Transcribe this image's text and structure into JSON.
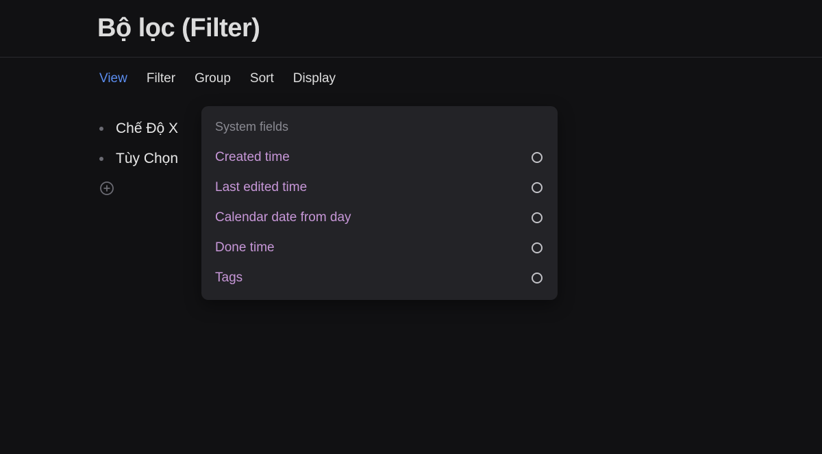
{
  "header": {
    "title": "Bộ lọc (Filter)"
  },
  "toolbar": {
    "tabs": [
      {
        "label": "View",
        "active": true
      },
      {
        "label": "Filter",
        "active": false
      },
      {
        "label": "Group",
        "active": false
      },
      {
        "label": "Sort",
        "active": false
      },
      {
        "label": "Display",
        "active": false
      }
    ]
  },
  "content": {
    "items": [
      {
        "text": "Chế Độ X"
      },
      {
        "text": "Tùy Chọn"
      }
    ]
  },
  "dropdown": {
    "header": "System fields",
    "options": [
      {
        "label": "Created time"
      },
      {
        "label": "Last edited time"
      },
      {
        "label": "Calendar date from day"
      },
      {
        "label": "Done time"
      },
      {
        "label": "Tags"
      }
    ]
  }
}
